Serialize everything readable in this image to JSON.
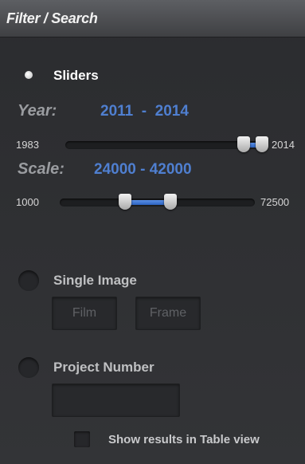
{
  "panel": {
    "title": "Filter / Search"
  },
  "sliders_option": {
    "label": "Sliders",
    "selected": true,
    "year": {
      "label": "Year:",
      "range_text": "2011  -  2014",
      "min_label": "1983",
      "max_label": "2014",
      "min": 1983,
      "max": 2014,
      "low": 2011,
      "high": 2014
    },
    "scale": {
      "label": "Scale:",
      "range_text": "24000 - 42000",
      "min_label": "1000",
      "max_label": "72500",
      "min": 1000,
      "max": 72500,
      "low": 24000,
      "high": 42000
    }
  },
  "single_image_option": {
    "label": "Single Image",
    "selected": false,
    "film_placeholder": "Film",
    "frame_placeholder": "Frame"
  },
  "project_number_option": {
    "label": "Project Number",
    "selected": false,
    "input_value": ""
  },
  "table_view": {
    "label": "Show results in Table view",
    "checked": false
  },
  "colors": {
    "accent": "#4f7fd0",
    "background": "#2f3033"
  }
}
